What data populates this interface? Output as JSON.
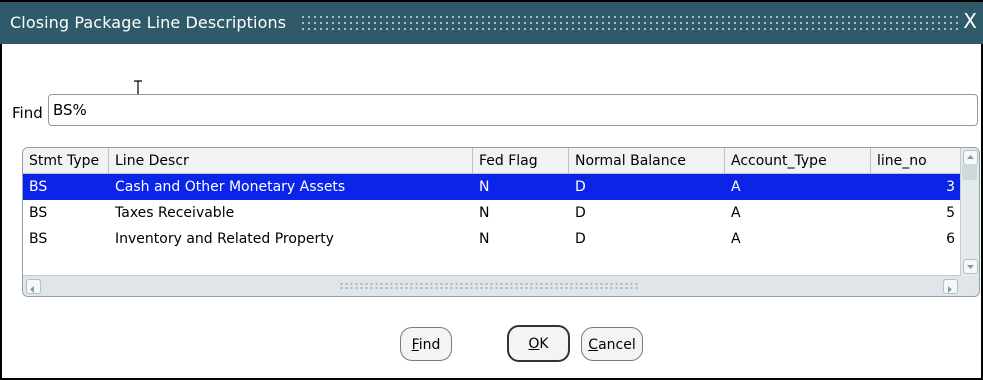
{
  "window": {
    "title": "Closing Package Line Descriptions",
    "close_glyph": "X"
  },
  "find": {
    "label": "Find",
    "value": "BS%"
  },
  "table": {
    "headers": [
      "Stmt Type",
      "Line Descr",
      "Fed Flag",
      "Normal Balance",
      "Account_Type",
      "line_no"
    ],
    "rows": [
      {
        "stmt_type": "BS",
        "line_descr": "Cash and Other Monetary Assets",
        "fed_flag": "N",
        "normal_balance": "D",
        "account_type": "A",
        "line_no": "3",
        "selected": true
      },
      {
        "stmt_type": "BS",
        "line_descr": "Taxes Receivable",
        "fed_flag": "N",
        "normal_balance": "D",
        "account_type": "A",
        "line_no": "5",
        "selected": false
      },
      {
        "stmt_type": "BS",
        "line_descr": "Inventory and Related Property",
        "fed_flag": "N",
        "normal_balance": "D",
        "account_type": "A",
        "line_no": "6",
        "selected": false
      }
    ]
  },
  "buttons": {
    "find": {
      "mnemonic": "F",
      "rest": "ind"
    },
    "ok": {
      "mnemonic": "O",
      "rest": "K"
    },
    "cancel": {
      "mnemonic": "C",
      "rest": "ancel"
    }
  },
  "colors": {
    "titlebar": "#2f5a6a",
    "selection": "#0a24e8"
  }
}
